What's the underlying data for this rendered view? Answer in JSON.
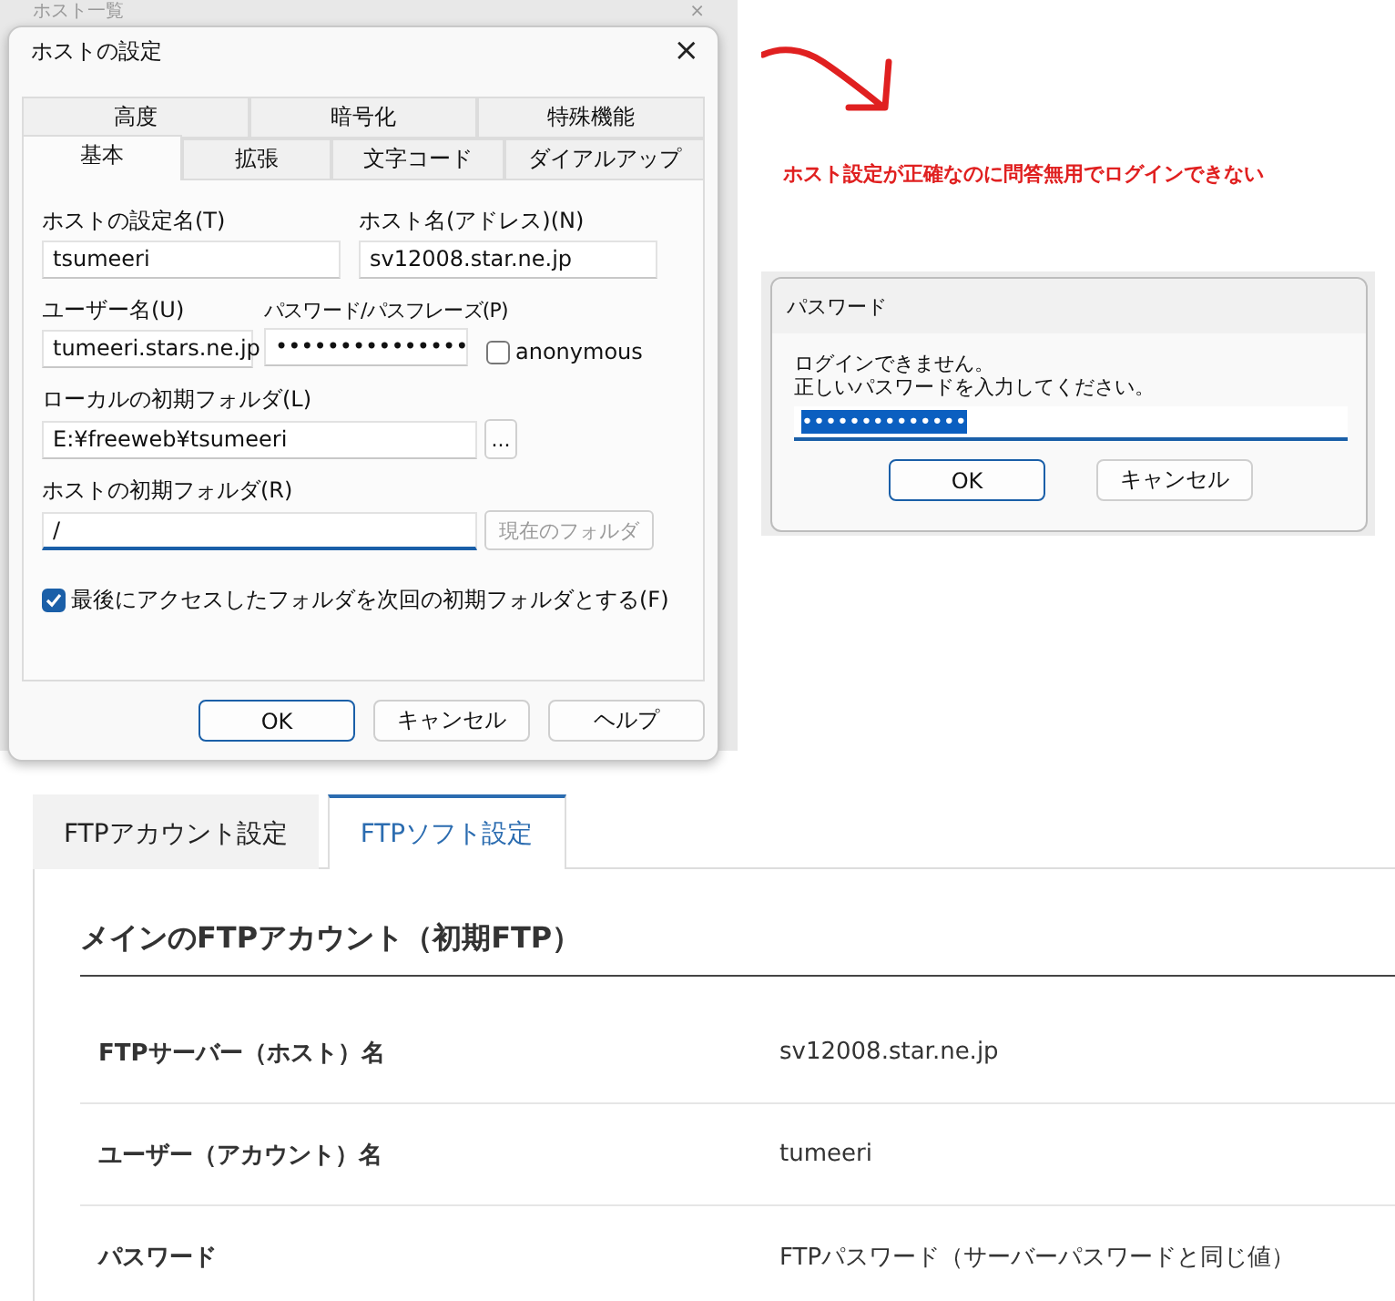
{
  "host_list_window": {
    "title": "ホスト一覧",
    "close": "×"
  },
  "host_dialog": {
    "title": "ホストの設定",
    "close": "×",
    "tab_rows": [
      [
        {
          "label": "高度",
          "selected": false
        },
        {
          "label": "暗号化",
          "selected": false
        },
        {
          "label": "特殊機能",
          "selected": false
        }
      ],
      [
        {
          "label": "基本",
          "selected": true
        },
        {
          "label": "拡張",
          "selected": false
        },
        {
          "label": "文字コード",
          "selected": false
        },
        {
          "label": "ダイアルアップ",
          "selected": false
        }
      ]
    ],
    "host_setting_name": {
      "label": "ホストの設定名(T)",
      "value": "tsumeeri"
    },
    "host_name": {
      "label": "ホスト名(アドレス)(N)",
      "value": "sv12008.star.ne.jp"
    },
    "user_name": {
      "label": "ユーザー名(U)",
      "value": "tumeeri.stars.ne.jp"
    },
    "password": {
      "label": "パスワード/パスフレーズ(P)",
      "value": "•••••••••••••••"
    },
    "anonymous": {
      "label": "anonymous",
      "checked": false
    },
    "local_folder": {
      "label": "ローカルの初期フォルダ(L)",
      "value": "E:¥freeweb¥tsumeeri",
      "browse": "..."
    },
    "host_folder": {
      "label": "ホストの初期フォルダ(R)",
      "value": "/",
      "button": {
        "label": "現在のフォルダ",
        "disabled": true
      }
    },
    "last_folder": {
      "label": "最後にアクセスしたフォルダを次回の初期フォルダとする(F)",
      "checked": true
    },
    "buttons": [
      {
        "label": "OK",
        "default": true
      },
      {
        "label": "キャンセル",
        "default": false
      },
      {
        "label": "ヘルプ",
        "default": false
      }
    ]
  },
  "note": "ホスト設定が正確なのに問答無用でログインできない",
  "password_dialog": {
    "title": "パスワード",
    "message_lines": [
      "ログインできません。",
      "正しいパスワードを入力してください。"
    ],
    "value": "••••••••••••••",
    "buttons": [
      {
        "label": "OK",
        "default": true
      },
      {
        "label": "キャンセル",
        "default": false
      }
    ]
  },
  "web": {
    "tabs": [
      {
        "label": "FTPアカウント設定",
        "selected": false
      },
      {
        "label": "FTPソフト設定",
        "selected": true
      }
    ],
    "heading": "メインのFTPアカウント（初期FTP）",
    "rows": [
      {
        "label": "FTPサーバー（ホスト）名",
        "value": "sv12008.star.ne.jp"
      },
      {
        "label": "ユーザー（アカウント）名",
        "value": "tumeeri"
      },
      {
        "label": "パスワード",
        "value": "FTPパスワード（サーバーパスワードと同じ値）"
      }
    ]
  }
}
